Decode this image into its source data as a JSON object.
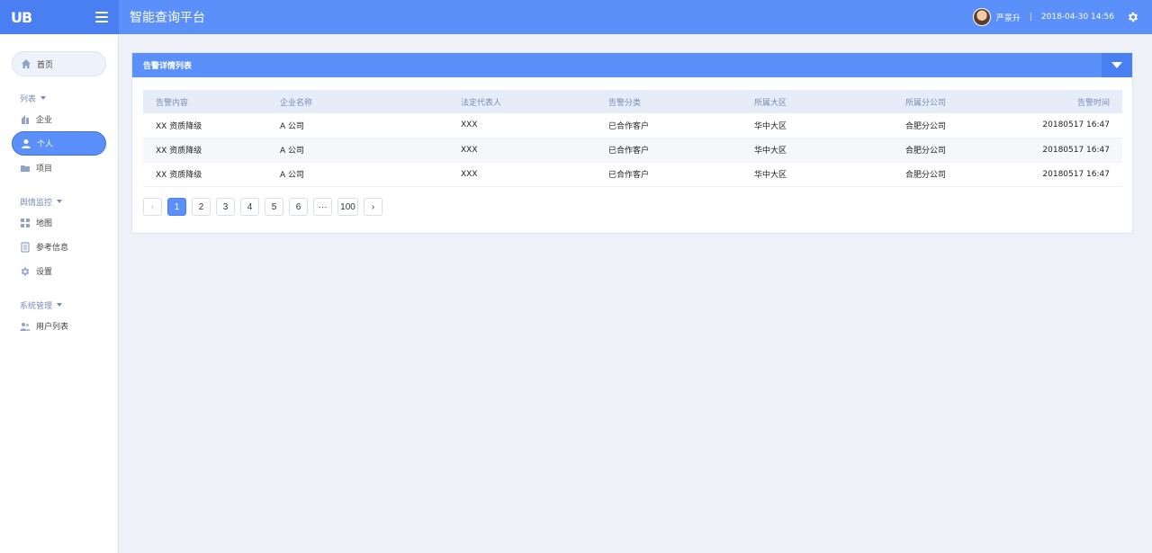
{
  "topbar": {
    "logo": "UB",
    "title": "智能查询平台",
    "username": "严景升",
    "separator": "|",
    "datetime": "2018-04-30 14:56"
  },
  "sidebar": {
    "home": "首页",
    "group_list": "列表",
    "enterprise": "企业",
    "personal": "个人",
    "project": "项目",
    "group_monitor": "舆情监控",
    "map": "地图",
    "reference": "参考信息",
    "settings": "设置",
    "group_system": "系统管理",
    "user_list": "用户列表"
  },
  "panel": {
    "title": "告警详情列表",
    "columns": [
      "告警内容",
      "企业名称",
      "法定代表人",
      "告警分类",
      "所属大区",
      "所属分公司",
      "告警时间"
    ],
    "rows": [
      [
        "XX 资质降级",
        "A 公司",
        "XXX",
        "已合作客户",
        "华中大区",
        "合肥分公司",
        "20180517 16:47"
      ],
      [
        "XX 资质降级",
        "A 公司",
        "XXX",
        "已合作客户",
        "华中大区",
        "合肥分公司",
        "20180517 16:47"
      ],
      [
        "XX 资质降级",
        "A 公司",
        "XXX",
        "已合作客户",
        "华中大区",
        "合肥分公司",
        "20180517 16:47"
      ]
    ]
  },
  "pager": {
    "prev": "‹",
    "pages": [
      "1",
      "2",
      "3",
      "4",
      "5",
      "6"
    ],
    "ellipsis": "···",
    "last": "100",
    "next": "›",
    "current": "1"
  },
  "colors": {
    "accent": "#5b8ff9",
    "accent_dark": "#4a7ff2",
    "background": "#eef1f8"
  },
  "icons": [
    "menu-icon",
    "gear-icon",
    "home-icon",
    "building-icon",
    "person-icon",
    "folder-icon",
    "map-icon",
    "document-icon",
    "settings-icon",
    "users-icon",
    "chevron-down-icon"
  ]
}
